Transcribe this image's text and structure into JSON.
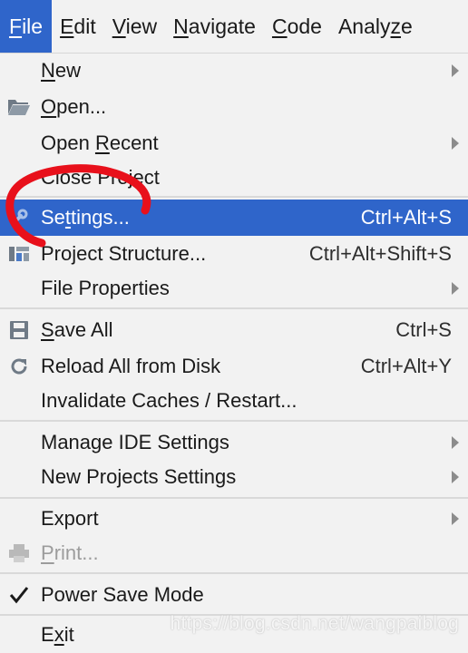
{
  "menubar": {
    "file": {
      "mn": "F",
      "rest": "ile"
    },
    "edit": {
      "mn": "E",
      "rest": "dit"
    },
    "view": {
      "mn": "V",
      "rest": "iew"
    },
    "navigate": {
      "mn": "N",
      "rest": "avigate"
    },
    "code": {
      "mn": "C",
      "rest": "ode"
    },
    "analyze": {
      "pre": "Analy",
      "mn": "z",
      "rest": "e"
    }
  },
  "items": {
    "new": {
      "mn": "N",
      "rest": "ew"
    },
    "open": {
      "mn": "O",
      "rest": "pen..."
    },
    "open_recent": {
      "pre": "Open ",
      "mn": "R",
      "rest": "ecent"
    },
    "close_project": {
      "label": "Close Project"
    },
    "settings": {
      "pre": "Se",
      "mn": "t",
      "rest": "tings...",
      "shortcut": "Ctrl+Alt+S"
    },
    "project_structure": {
      "label": "Project Structure...",
      "shortcut": "Ctrl+Alt+Shift+S"
    },
    "file_properties": {
      "label": "File Properties"
    },
    "save_all": {
      "mn": "S",
      "rest": "ave All",
      "shortcut": "Ctrl+S"
    },
    "reload": {
      "label": "Reload All from Disk",
      "shortcut": "Ctrl+Alt+Y"
    },
    "invalidate": {
      "label": "Invalidate Caches / Restart..."
    },
    "manage_ide": {
      "label": "Manage IDE Settings"
    },
    "new_projects": {
      "label": "New Projects Settings"
    },
    "export": {
      "label": "Export"
    },
    "print": {
      "mn": "P",
      "rest": "rint..."
    },
    "power_save": {
      "label": "Power Save Mode"
    },
    "exit": {
      "pre": "E",
      "mn": "x",
      "rest": "it"
    }
  },
  "watermark": "https://blog.csdn.net/wangpaiblog",
  "colors": {
    "selection": "#2f65ca",
    "annotation": "#e8101b"
  }
}
